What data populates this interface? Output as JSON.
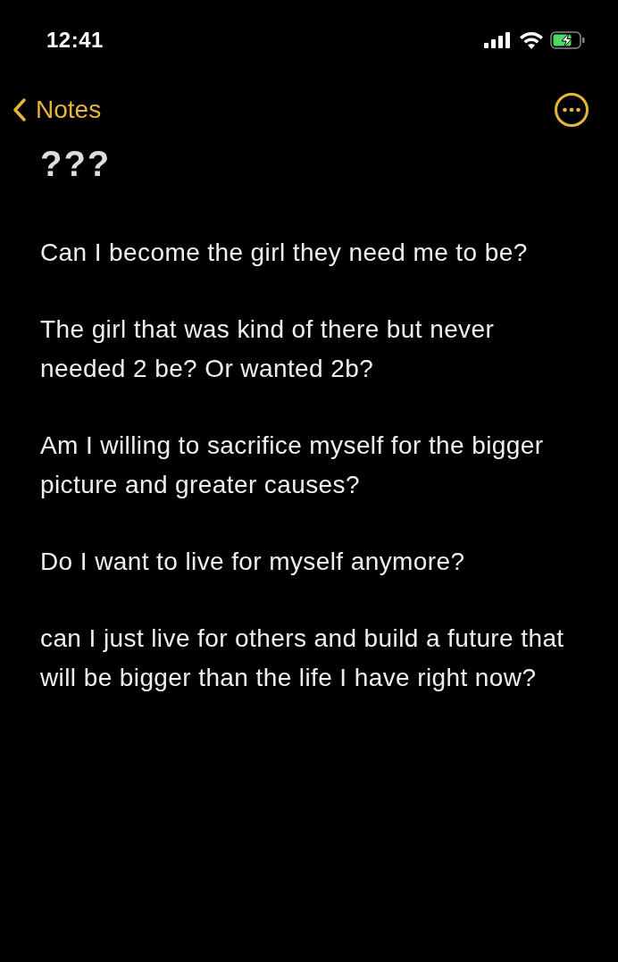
{
  "status_bar": {
    "time": "12:41"
  },
  "nav": {
    "back_label": "Notes"
  },
  "note": {
    "title": "???",
    "paragraphs": [
      "Can I become the girl they need me to be?",
      "The girl that was kind of there but never needed 2 be? Or wanted 2b?",
      "Am I willing to sacrifice myself for the bigger picture and greater causes?",
      "Do I want to live for myself anymore?",
      "can I just live for others and build a future that will be bigger than the life I have right now?"
    ]
  }
}
